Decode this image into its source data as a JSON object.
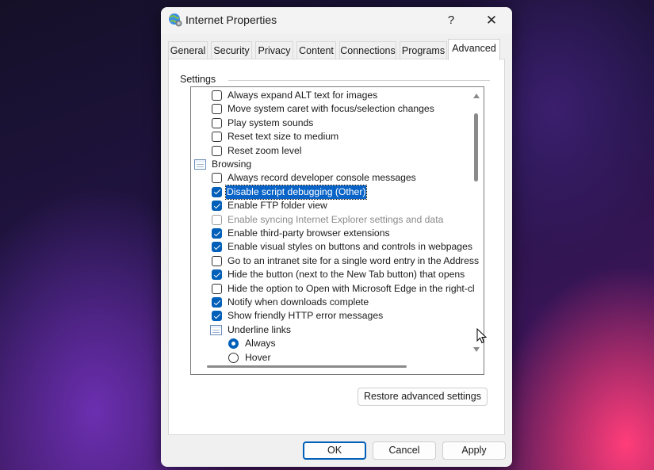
{
  "window": {
    "title": "Internet Properties",
    "help_label": "?",
    "close_label": "✕"
  },
  "tabs": [
    {
      "label": "General"
    },
    {
      "label": "Security"
    },
    {
      "label": "Privacy"
    },
    {
      "label": "Content"
    },
    {
      "label": "Connections"
    },
    {
      "label": "Programs"
    },
    {
      "label": "Advanced",
      "active": true
    }
  ],
  "settings": {
    "group_label": "Settings",
    "items": [
      {
        "type": "checkbox",
        "label": "Always expand ALT text for images",
        "checked": false
      },
      {
        "type": "checkbox",
        "label": "Move system caret with focus/selection changes",
        "checked": false
      },
      {
        "type": "checkbox",
        "label": "Play system sounds",
        "checked": false
      },
      {
        "type": "checkbox",
        "label": "Reset text size to medium",
        "checked": false
      },
      {
        "type": "checkbox",
        "label": "Reset zoom level",
        "checked": false
      },
      {
        "type": "category",
        "label": "Browsing"
      },
      {
        "type": "checkbox",
        "label": "Always record developer console messages",
        "checked": false
      },
      {
        "type": "checkbox",
        "label": "Disable script debugging (Other)",
        "checked": true,
        "selected": true
      },
      {
        "type": "checkbox",
        "label": "Enable FTP folder view",
        "checked": true
      },
      {
        "type": "checkbox",
        "label": "Enable syncing Internet Explorer settings and data",
        "checked": false,
        "disabled": true
      },
      {
        "type": "checkbox",
        "label": "Enable third-party browser extensions",
        "checked": true
      },
      {
        "type": "checkbox",
        "label": "Enable visual styles on buttons and controls in webpages",
        "checked": true
      },
      {
        "type": "checkbox",
        "label": "Go to an intranet site for a single word entry in the Address",
        "checked": false
      },
      {
        "type": "checkbox",
        "label": "Hide the button (next to the New Tab button) that opens",
        "checked": true
      },
      {
        "type": "checkbox",
        "label": "Hide the option to Open with Microsoft Edge in the right-cl",
        "checked": false
      },
      {
        "type": "checkbox",
        "label": "Notify when downloads complete",
        "checked": true
      },
      {
        "type": "checkbox",
        "label": "Show friendly HTTP error messages",
        "checked": true
      },
      {
        "type": "subcategory",
        "label": "Underline links"
      },
      {
        "type": "radio",
        "label": "Always",
        "selected": true
      },
      {
        "type": "radio",
        "label": "Hover",
        "selected": false
      }
    ]
  },
  "buttons": {
    "restore": "Restore advanced settings",
    "ok": "OK",
    "cancel": "Cancel",
    "apply": "Apply"
  },
  "colors": {
    "accent": "#005fb8",
    "selection": "#0a64c8"
  }
}
